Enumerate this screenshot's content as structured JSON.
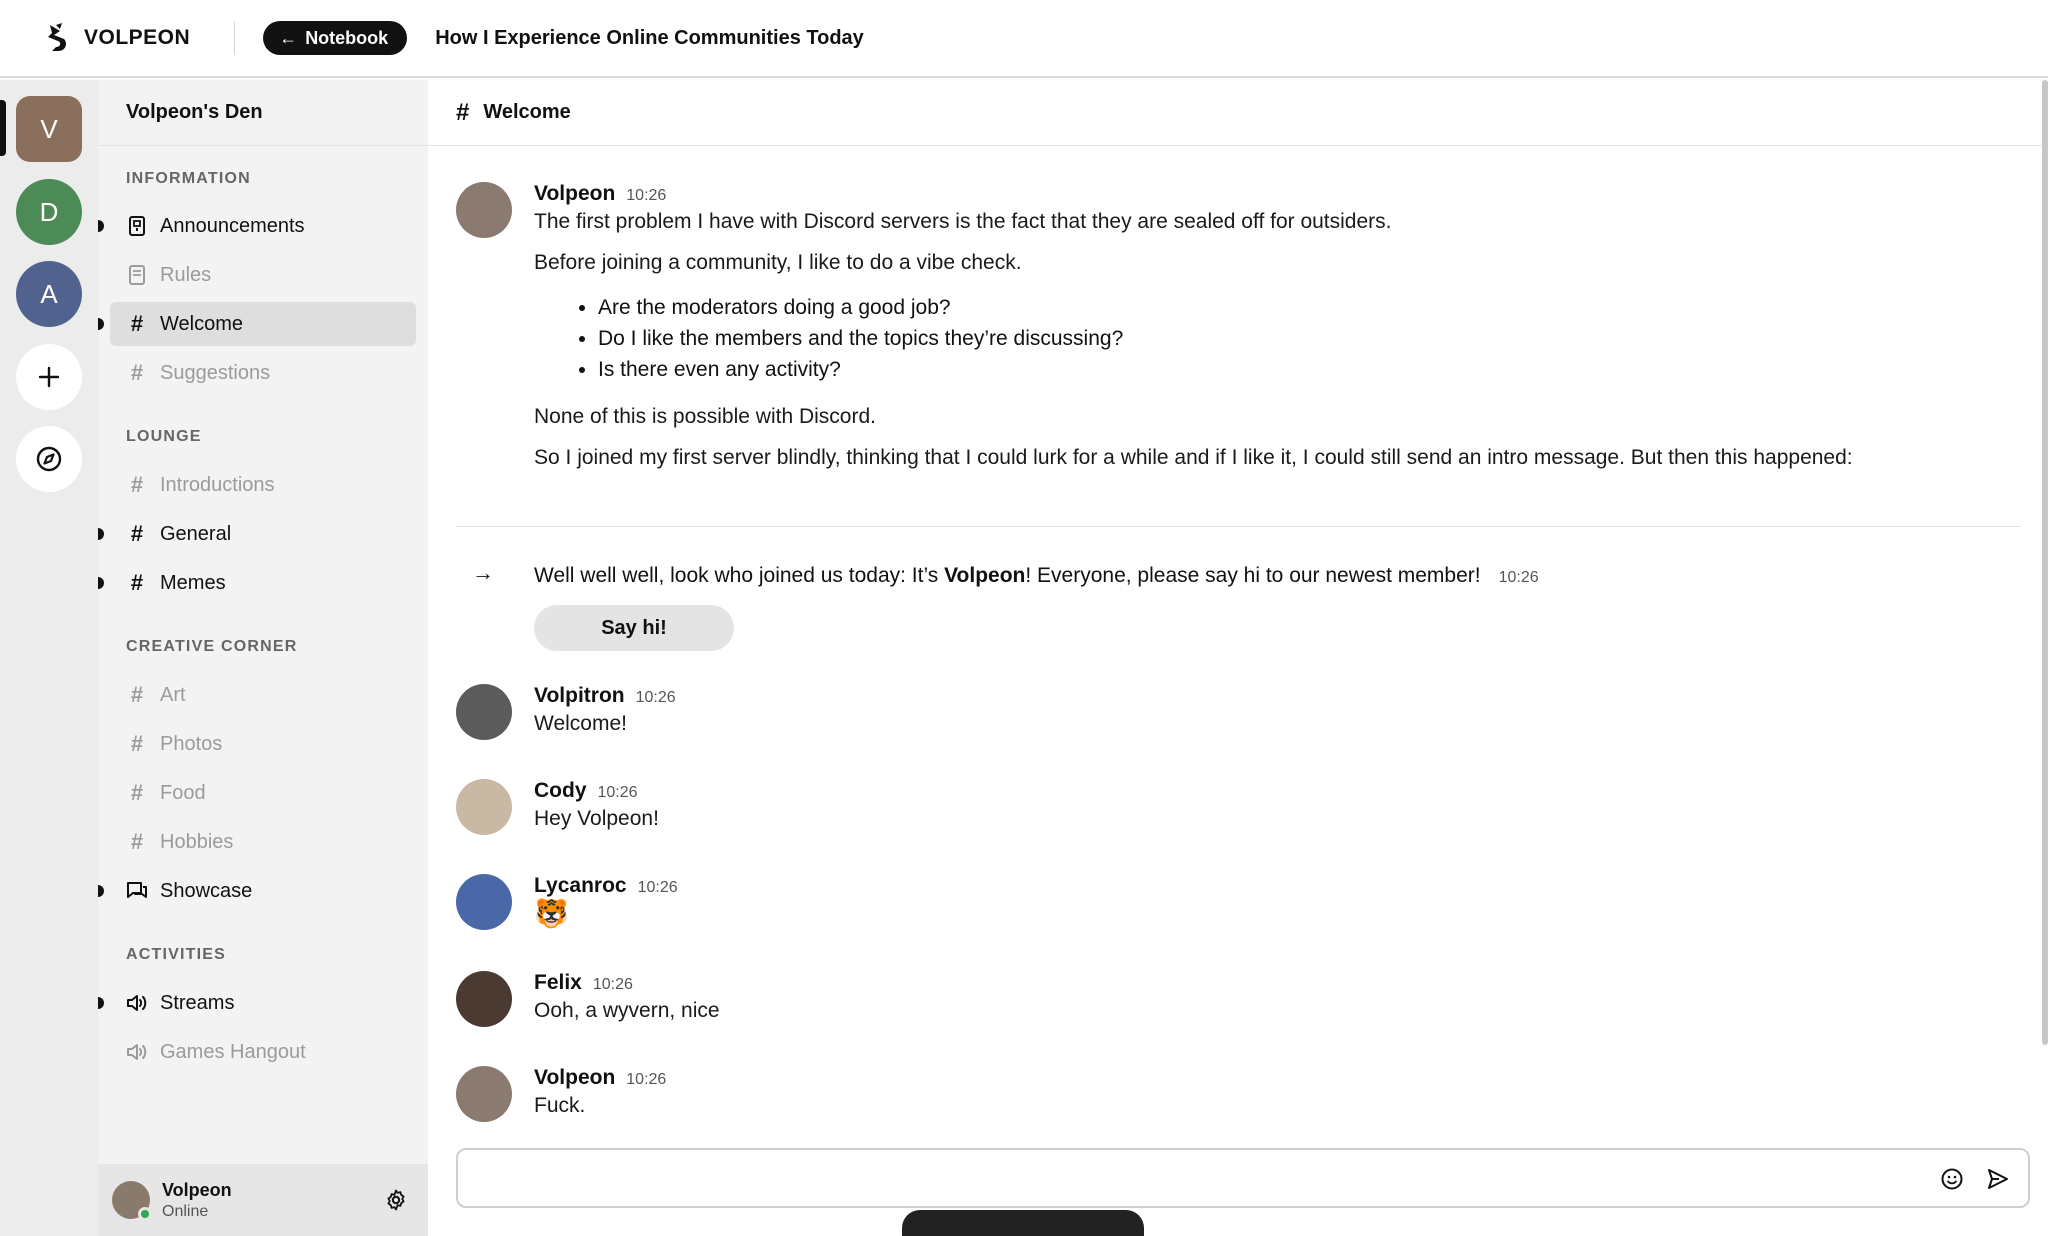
{
  "topbar": {
    "brand": "VOLPEON",
    "back_label": "Notebook",
    "doc_title": "How I Experience Online Communities Today"
  },
  "servers": [
    {
      "letter": "V",
      "color": "#8a6f5d"
    },
    {
      "letter": "D",
      "color": "#4c8b55"
    },
    {
      "letter": "A",
      "color": "#51628f"
    }
  ],
  "sidebar": {
    "server_name": "Volpeon's Den",
    "categories": [
      "INFORMATION",
      "LOUNGE",
      "CREATIVE CORNER",
      "ACTIVITIES"
    ],
    "channels": {
      "announcements": "Announcements",
      "rules": "Rules",
      "welcome": "Welcome",
      "suggestions": "Suggestions",
      "introductions": "Introductions",
      "general": "General",
      "memes": "Memes",
      "art": "Art",
      "photos": "Photos",
      "food": "Food",
      "hobbies": "Hobbies",
      "showcase": "Showcase",
      "streams": "Streams",
      "games_hangout": "Games Hangout"
    },
    "user": {
      "name": "Volpeon",
      "status": "Online"
    }
  },
  "channel_header": {
    "title": "Welcome"
  },
  "messages": {
    "m1": {
      "author": "Volpeon",
      "time": "10:26",
      "p1": "The first problem I have with Discord servers is the fact that they are sealed off for outsiders.",
      "p2": "Before joining a community, I like to do a vibe check.",
      "bullets": [
        "Are the moderators doing a good job?",
        "Do I like the members and the topics they’re discussing?",
        "Is there even any activity?"
      ],
      "p3": "None of this is possible with Discord.",
      "p4": "So I joined my first server blindly, thinking that I could lurk for a while and if I like it, I could still send an intro message. But then this happened:"
    },
    "join": {
      "pre": "Well well well, look who joined us today: It’s ",
      "name": "Volpeon",
      "post": "! Everyone, please say hi to our newest member!",
      "time": "10:26",
      "button": "Say hi!"
    },
    "m2": {
      "author": "Volpitron",
      "time": "10:26",
      "text": "Welcome!"
    },
    "m3": {
      "author": "Cody",
      "time": "10:26",
      "text": "Hey Volpeon!"
    },
    "m4": {
      "author": "Lycanroc",
      "time": "10:26",
      "text": "🐯"
    },
    "m5": {
      "author": "Felix",
      "time": "10:26",
      "text": "Ooh, a wyvern, nice"
    },
    "m6": {
      "author": "Volpeon",
      "time": "10:26",
      "text": "Fuck."
    }
  },
  "composer": {
    "placeholder": ""
  }
}
